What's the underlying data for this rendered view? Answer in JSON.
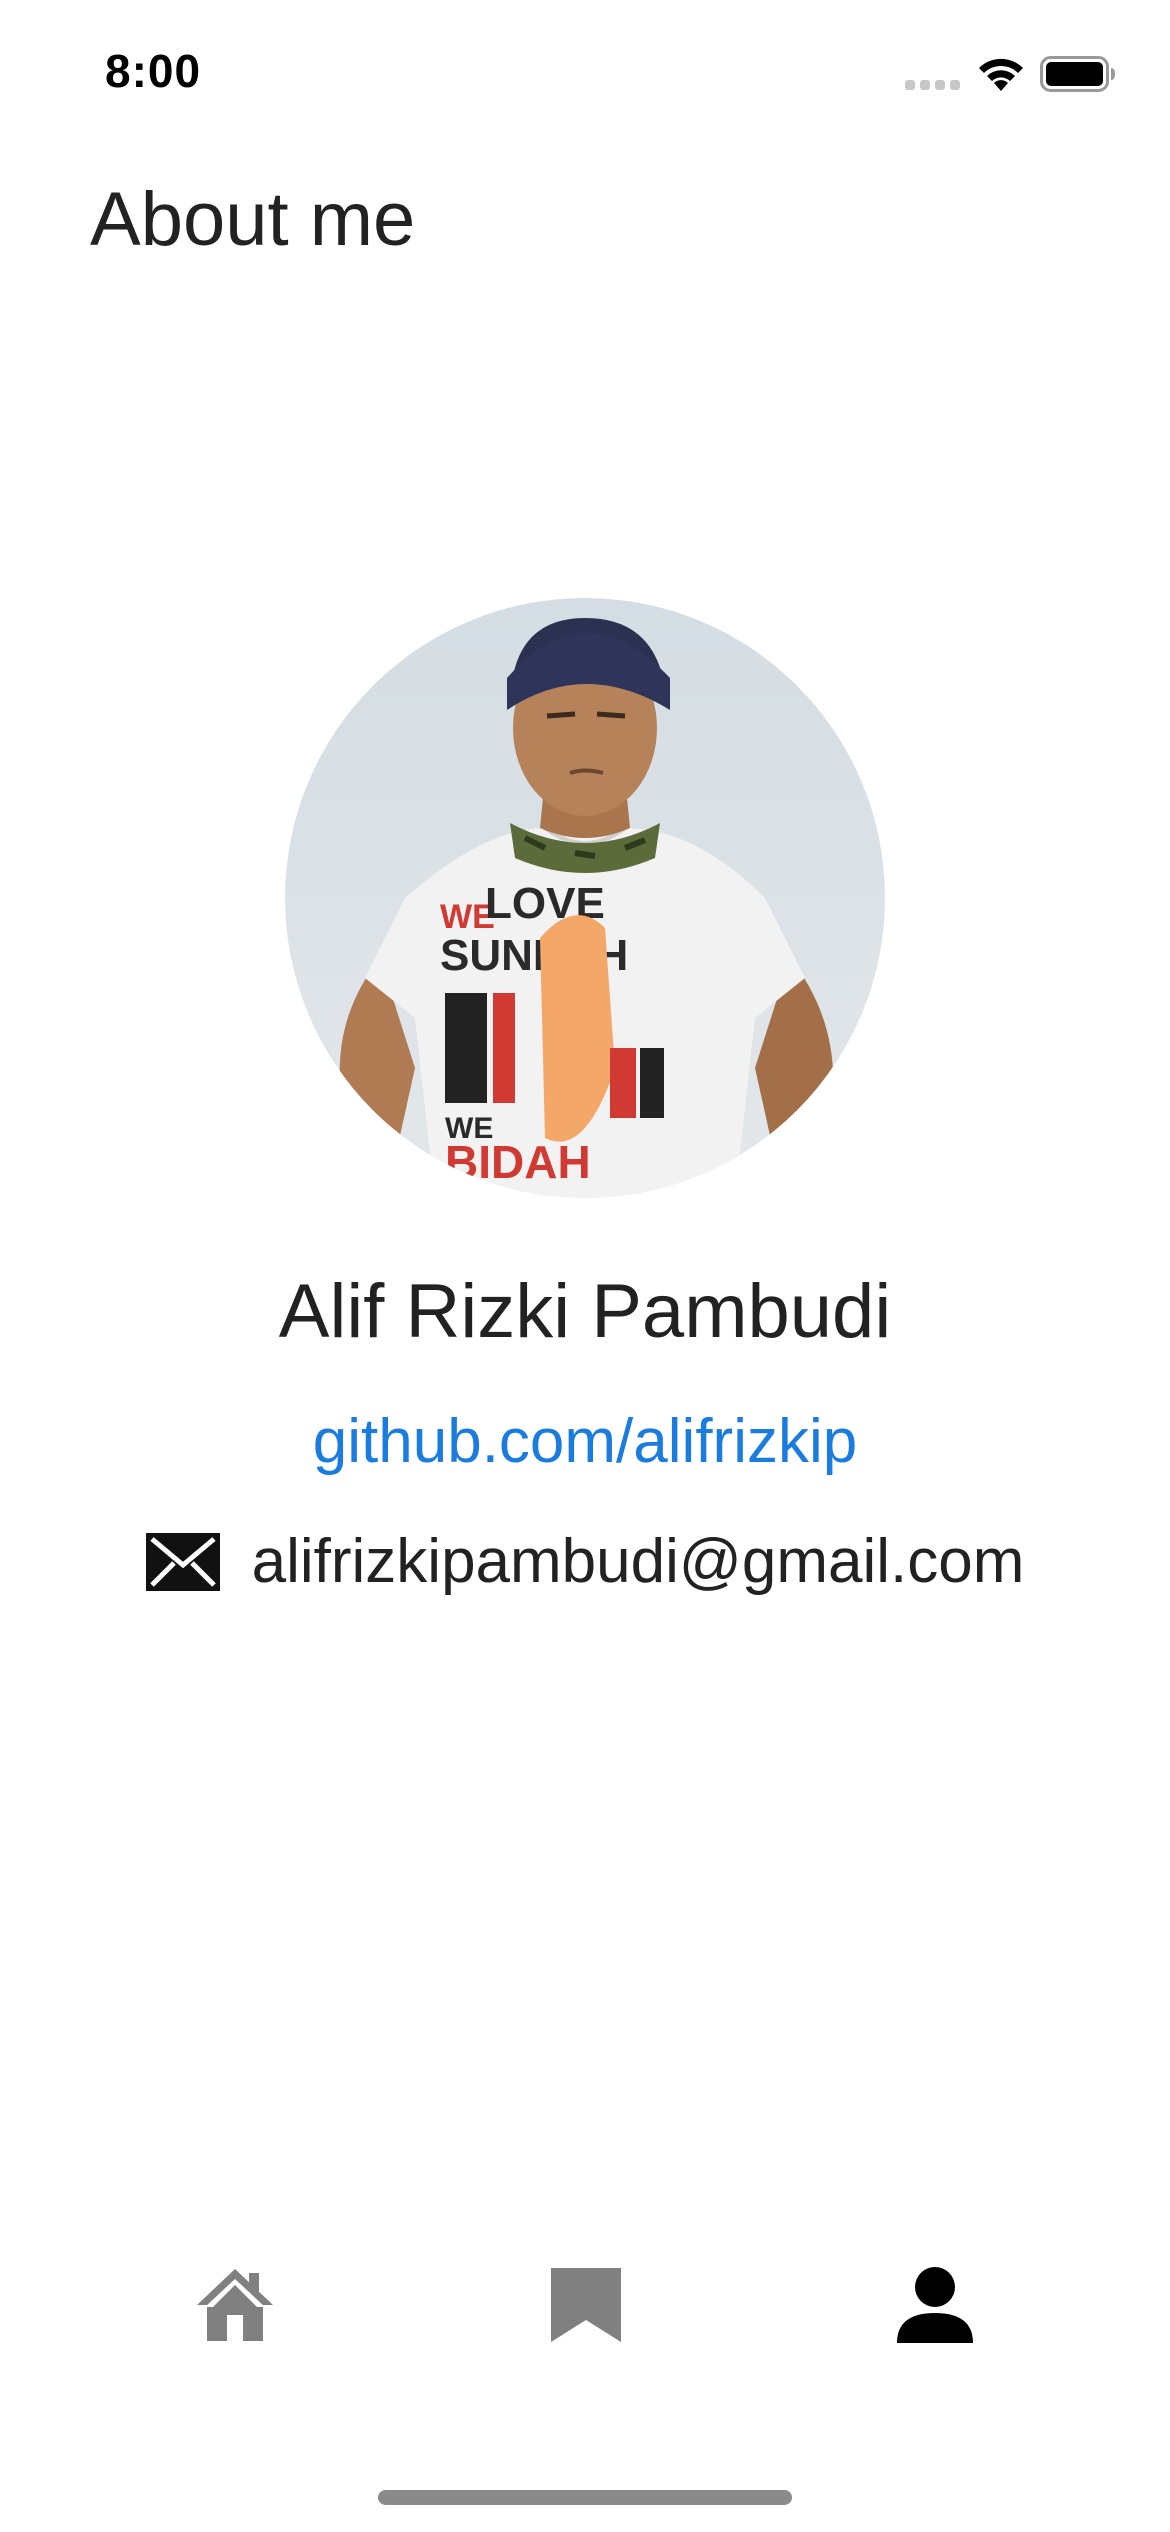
{
  "status_bar": {
    "time": "8:00",
    "icons": [
      "signal-icon",
      "wifi-icon",
      "battery-icon"
    ]
  },
  "header": {
    "title": "About me"
  },
  "profile": {
    "avatar_alt": "profile photo",
    "name": "Alif Rizki Pambudi",
    "link_text": "github.com/alifrizkip",
    "email": "alifrizkipambudi@gmail.com",
    "link_color": "#1b7cdf"
  },
  "tab_bar": {
    "tabs": [
      {
        "icon": "home-icon",
        "active": false
      },
      {
        "icon": "bookmark-icon",
        "active": false
      },
      {
        "icon": "person-icon",
        "active": true
      }
    ],
    "active_color": "#000000",
    "inactive_color": "#808080"
  }
}
